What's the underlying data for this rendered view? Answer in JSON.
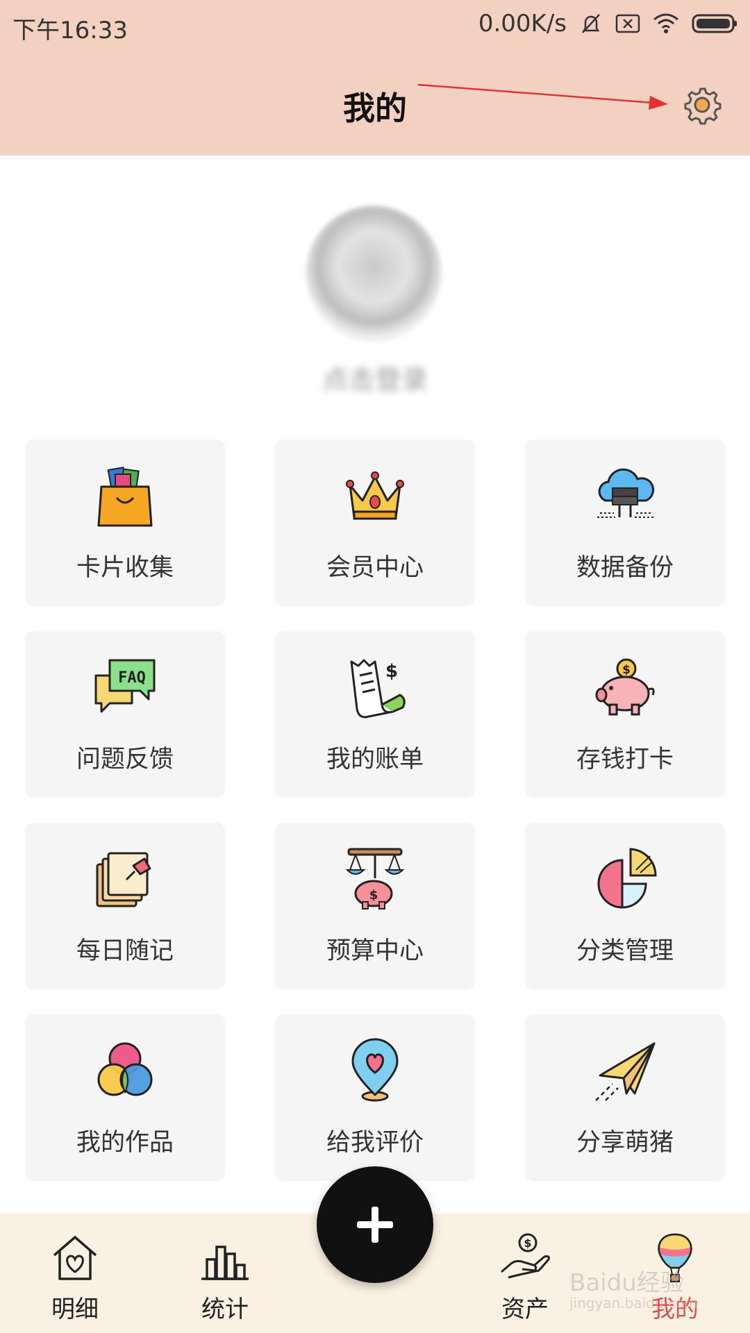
{
  "status_bar": {
    "time": "下午16:33",
    "network_speed": "0.00K/s",
    "icons": [
      "mute-bell-icon",
      "sim-off-icon",
      "wifi-icon",
      "battery-icon"
    ]
  },
  "header": {
    "title": "我的",
    "settings_icon": "gear-icon",
    "annotation": "red-arrow-to-settings"
  },
  "profile": {
    "login_text": "点击登录"
  },
  "grid": {
    "items": [
      {
        "label": "卡片收集",
        "icon": "shopping-bag-cards-icon"
      },
      {
        "label": "会员中心",
        "icon": "crown-icon"
      },
      {
        "label": "数据备份",
        "icon": "cloud-server-icon"
      },
      {
        "label": "问题反馈",
        "icon": "faq-chat-icon"
      },
      {
        "label": "我的账单",
        "icon": "receipt-dollar-icon"
      },
      {
        "label": "存钱打卡",
        "icon": "piggy-bank-icon"
      },
      {
        "label": "每日随记",
        "icon": "notes-pin-icon"
      },
      {
        "label": "预算中心",
        "icon": "scale-piggy-icon"
      },
      {
        "label": "分类管理",
        "icon": "pie-chart-icon"
      },
      {
        "label": "我的作品",
        "icon": "color-circles-icon"
      },
      {
        "label": "给我评价",
        "icon": "heart-pin-icon"
      },
      {
        "label": "分享萌猪",
        "icon": "paper-plane-icon"
      }
    ]
  },
  "bottom_nav": {
    "items": [
      {
        "label": "明细",
        "icon": "heart-house-icon"
      },
      {
        "label": "统计",
        "icon": "bar-chart-icon"
      },
      {
        "label": "资产",
        "icon": "hand-coin-icon"
      },
      {
        "label": "我的",
        "icon": "balloon-icon",
        "active": true
      }
    ],
    "add_icon": "plus-icon"
  },
  "watermark": {
    "text": "Baidu经验",
    "sub": "jingyan.baidu.com"
  },
  "colors": {
    "header_bg": "#f2d1c1",
    "tile_bg": "#f5f5f5",
    "nav_bg": "#fbf1e2",
    "active": "#e64c4c"
  }
}
